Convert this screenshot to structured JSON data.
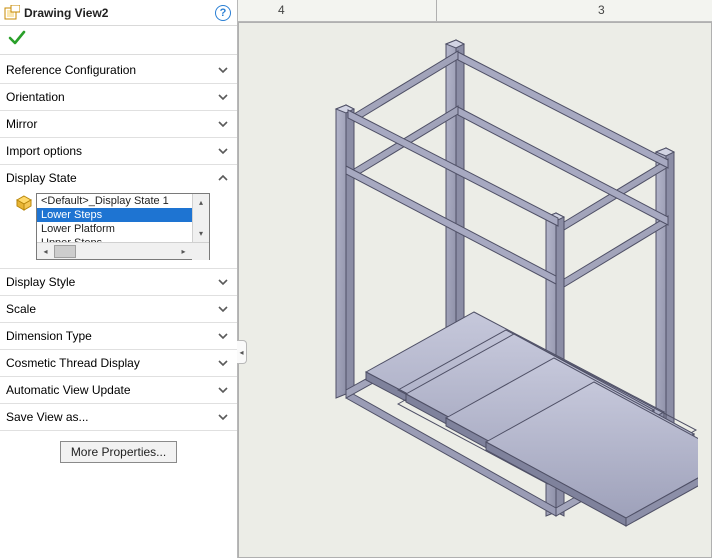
{
  "panel": {
    "title": "Drawing View2",
    "help_tooltip": "Help"
  },
  "sections": {
    "reference": "Reference Configuration",
    "orientation": "Orientation",
    "mirror": "Mirror",
    "import": "Import options",
    "displayState": "Display State",
    "displayStyle": "Display Style",
    "scale": "Scale",
    "dimension": "Dimension Type",
    "cosmetic": "Cosmetic Thread Display",
    "autoUpdate": "Automatic View Update",
    "saveAs": "Save View as..."
  },
  "displayState": {
    "items": [
      "<Default>_Display State 1",
      "Lower Steps",
      "Lower Platform",
      "Upper Steps"
    ],
    "selected_index": 1
  },
  "more_properties": "More Properties...",
  "ruler": {
    "left_num": "4",
    "right_num": "3"
  }
}
